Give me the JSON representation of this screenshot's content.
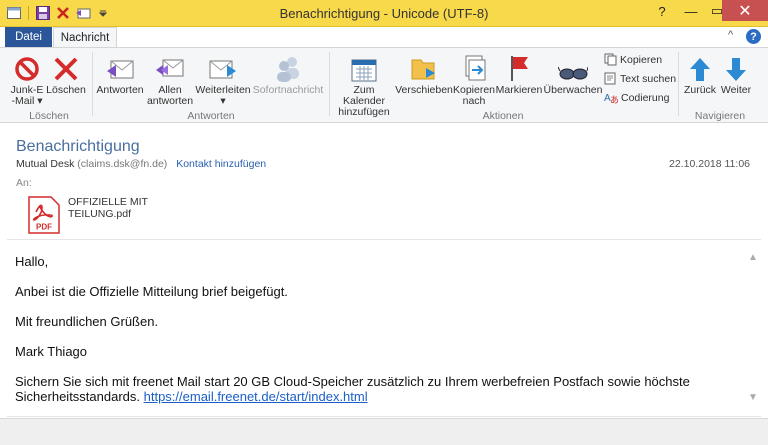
{
  "window": {
    "title": "Benachrichtigung - Unicode (UTF-8)",
    "help_label": "?",
    "minimize_label": "—",
    "maximize_label": "▭",
    "close_label": "✕"
  },
  "tabs": {
    "file": "Datei",
    "message": "Nachricht",
    "collapse": "^",
    "help": "?"
  },
  "ribbon": {
    "groups": {
      "delete": "Löschen",
      "respond": "Antworten",
      "actions": "Aktionen",
      "navigate": "Navigieren"
    },
    "buttons": {
      "junk_line1": "Junk-E",
      "junk_line2": "-Mail ▾",
      "delete": "Löschen",
      "reply": "Antworten",
      "reply_all_line1": "Allen",
      "reply_all_line2": "antworten",
      "forward": "Weiterleiten",
      "forward_arrow": "▾",
      "im": "Sofortnachricht",
      "calendar_line1": "Zum Kalender",
      "calendar_line2": "hinzufügen",
      "move": "Verschieben",
      "copy_to_line1": "Kopieren",
      "copy_to_line2": "nach",
      "mark": "Markieren",
      "watch": "Überwachen",
      "copy": "Kopieren",
      "find": "Text suchen",
      "encoding": "Codierung",
      "back": "Zurück",
      "next": "Weiter"
    }
  },
  "message": {
    "subject": "Benachrichtigung",
    "sender_name": "Mutual Desk",
    "sender_email": "(claims.dsk@fn.de)",
    "add_contact": "Kontakt hinzufügen",
    "date": "22.10.2018 11:06",
    "to_label": "An:",
    "attachment": {
      "badge": "PDF",
      "name": "OFFIZIELLE MITTEILUNG.pdf"
    },
    "body": {
      "greeting": "Hallo,",
      "line1": "Anbei ist die Offizielle Mitteilung brief beigefügt.",
      "line2": "Mit freundlichen Grüßen.",
      "signature": "Mark Thiago",
      "footer_line1": "Sichern Sie sich mit freenet Mail start 20 GB Cloud-Speicher zusätzlich zu Ihrem werbefreien Postfach sowie höchste",
      "footer_line2_text": "Sicherheitsstandards. ",
      "footer_link": "https://email.freenet.de/start/index.html"
    }
  },
  "colors": {
    "titlebar": "#f7d949",
    "file_tab": "#2b579a",
    "close_button": "#c75050",
    "link": "#1a5fc7",
    "subject": "#4a6f9d"
  }
}
